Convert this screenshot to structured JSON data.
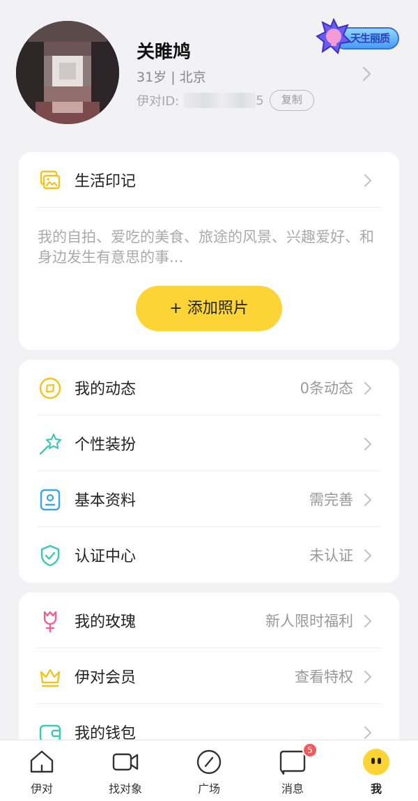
{
  "profile": {
    "name": "关睢鸠",
    "meta": "31岁 | 北京",
    "id_label": "伊对ID:",
    "id_tail": "5",
    "copy_label": "复制",
    "badge_text": "天生丽质"
  },
  "life": {
    "title": "生活印记",
    "description": "我的自拍、爱吃的美食、旅途的风景、兴趣爱好、和身边发生有意思的事...",
    "add_button": "+ 添加照片"
  },
  "menu_group1": [
    {
      "label": "我的动态",
      "value": "0条动态",
      "icon": "compass-icon"
    },
    {
      "label": "个性装扮",
      "value": "",
      "icon": "magic-wand-icon"
    },
    {
      "label": "基本资料",
      "value": "需完善",
      "icon": "profile-card-icon"
    },
    {
      "label": "认证中心",
      "value": "未认证",
      "icon": "shield-check-icon"
    }
  ],
  "menu_group2": [
    {
      "label": "我的玫瑰",
      "value": "新人限时福利",
      "icon": "rose-icon"
    },
    {
      "label": "伊对会员",
      "value": "查看特权",
      "icon": "crown-icon"
    },
    {
      "label": "我的钱包",
      "value": "",
      "icon": "wallet-icon"
    }
  ],
  "tabs": [
    {
      "label": "伊对",
      "icon": "home-icon"
    },
    {
      "label": "找对象",
      "icon": "video-camera-icon"
    },
    {
      "label": "广场",
      "icon": "compass-slash-icon"
    },
    {
      "label": "消息",
      "icon": "chat-bubble-icon",
      "badge": "5"
    },
    {
      "label": "我",
      "icon": "me-face-icon",
      "active": true
    }
  ],
  "colors": {
    "accent": "#fdd436",
    "badge_red": "#f05a5a",
    "icon_yellow": "#f3c21b",
    "icon_teal": "#3cc9b4",
    "icon_blue": "#3aa6e8",
    "icon_pink": "#f06292"
  }
}
